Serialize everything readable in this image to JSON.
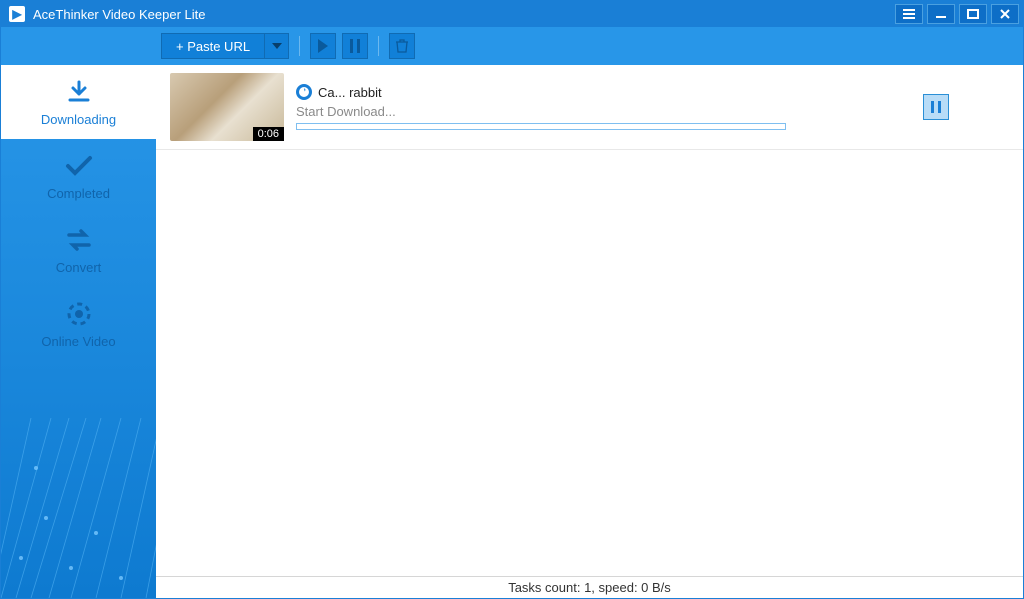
{
  "title": "AceThinker Video Keeper Lite",
  "toolbar": {
    "paste_url_label": "+ Paste URL"
  },
  "sidebar": {
    "items": [
      {
        "label": "Downloading",
        "icon": "download",
        "active": true
      },
      {
        "label": "Completed",
        "icon": "check",
        "active": false
      },
      {
        "label": "Convert",
        "icon": "convert",
        "active": false
      },
      {
        "label": "Online Video",
        "icon": "globe",
        "active": false
      }
    ]
  },
  "tasks": [
    {
      "title": "Ca... rabbit",
      "source_icon": "source-badge",
      "duration": "0:06",
      "status_text": "Start Download...",
      "progress_pct": 0
    }
  ],
  "status_bar": {
    "text": "Tasks count: 1, speed: 0 B/s"
  },
  "colors": {
    "accent": "#1a7fd6",
    "toolbar_bg": "#2896e8"
  }
}
